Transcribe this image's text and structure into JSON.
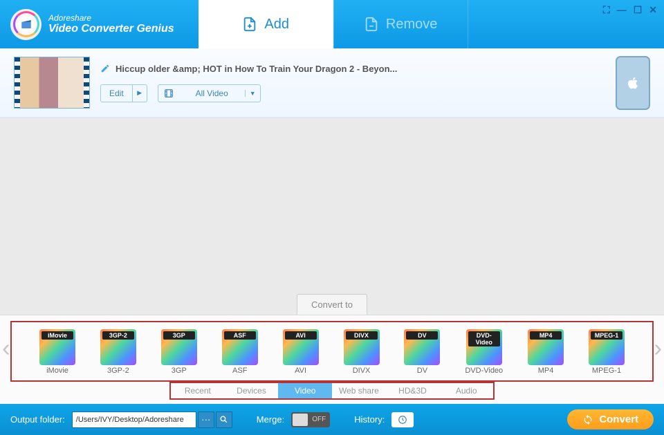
{
  "brand": {
    "top": "Adoreshare",
    "bottom": "Video Converter Genius"
  },
  "header": {
    "add": "Add",
    "remove": "Remove"
  },
  "file": {
    "title": "Hiccup  older &amp; HOT in How To Train Your Dragon 2 - Beyon...",
    "edit": "Edit",
    "dropdown": "All Video"
  },
  "convert_to": "Convert to",
  "formats": [
    {
      "badge": "iMovie",
      "label": "iMovie"
    },
    {
      "badge": "3GP-2",
      "label": "3GP-2"
    },
    {
      "badge": "3GP",
      "label": "3GP"
    },
    {
      "badge": "ASF",
      "label": "ASF"
    },
    {
      "badge": "AVI",
      "label": "AVI"
    },
    {
      "badge": "DIVX",
      "label": "DIVX"
    },
    {
      "badge": "DV",
      "label": "DV"
    },
    {
      "badge": "DVD-Video",
      "label": "DVD-Video"
    },
    {
      "badge": "MP4",
      "label": "MP4"
    },
    {
      "badge": "MPEG-1",
      "label": "MPEG-1"
    }
  ],
  "categories": [
    "Recent",
    "Devices",
    "Video",
    "Web share",
    "HD&3D",
    "Audio"
  ],
  "active_category": 2,
  "footer": {
    "output_label": "Output folder:",
    "output_path": "/Users/IVY/Desktop/Adoreshare",
    "browse": "···",
    "merge": "Merge:",
    "merge_state": "OFF",
    "history": "History:",
    "convert": "Convert"
  }
}
